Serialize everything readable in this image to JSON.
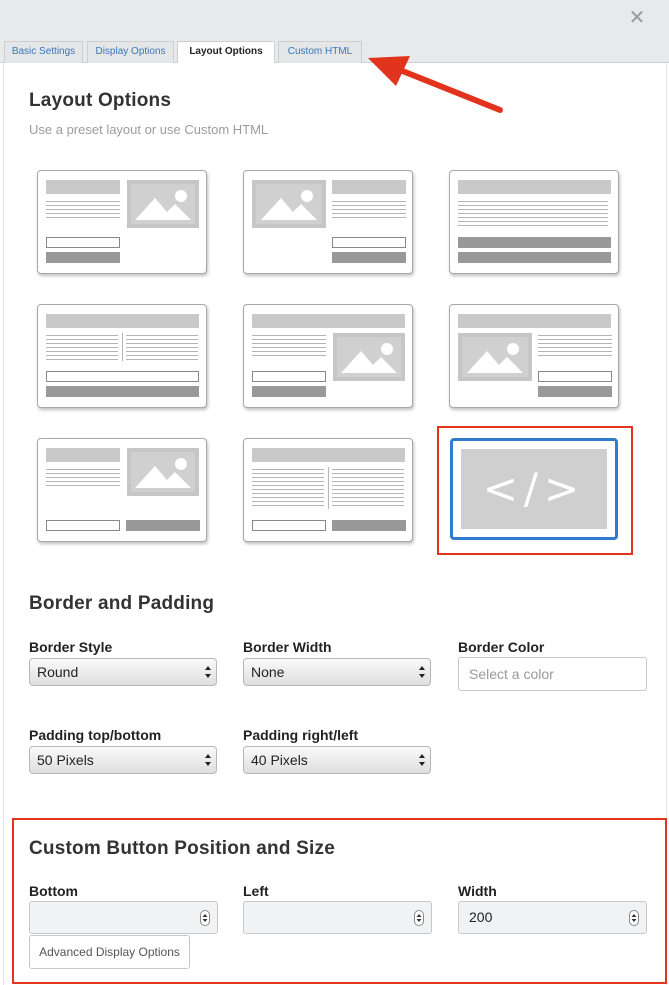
{
  "window": {
    "close_glyph": "✕"
  },
  "tabs": [
    {
      "label": "Basic Settings",
      "active": false
    },
    {
      "label": "Display Options",
      "active": false
    },
    {
      "label": "Layout Options",
      "active": true
    },
    {
      "label": "Custom HTML",
      "active": false
    }
  ],
  "layout_section": {
    "title": "Layout Options",
    "subtitle": "Use a preset layout or use Custom HTML",
    "custom_glyph": "</>",
    "selected_layout": "custom-html"
  },
  "border_section": {
    "title": "Border and Padding",
    "border_style": {
      "label": "Border Style",
      "value": "Round"
    },
    "border_width": {
      "label": "Border Width",
      "value": "None"
    },
    "border_color": {
      "label": "Border Color",
      "placeholder": "Select a color"
    },
    "padding_tb": {
      "label": "Padding top/bottom",
      "value": "50 Pixels"
    },
    "padding_rl": {
      "label": "Padding right/left",
      "value": "40 Pixels"
    }
  },
  "button_section": {
    "title": "Custom Button Position and Size",
    "bottom": {
      "label": "Bottom",
      "value": ""
    },
    "left": {
      "label": "Left",
      "value": ""
    },
    "width": {
      "label": "Width",
      "value": "200"
    },
    "advanced_button": "Advanced Display Options"
  },
  "colors": {
    "annotation_red": "#e2341d",
    "selected_blue": "#2f7ccc",
    "tab_link_blue": "#3a78b8"
  }
}
